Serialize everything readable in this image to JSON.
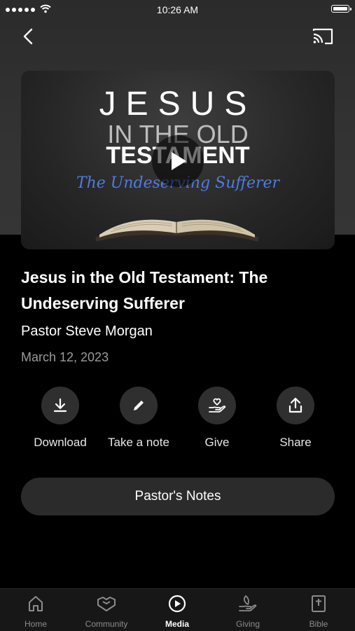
{
  "status_bar": {
    "time": "10:26 AM"
  },
  "thumbnail": {
    "line1": "JESUS",
    "line2": "IN THE OLD",
    "line3": "TESTAMENT",
    "line4": "The Undeserving Sufferer"
  },
  "sermon": {
    "title": "Jesus in the Old Testament: The Undeserving Sufferer",
    "pastor": "Pastor Steve Morgan",
    "date": "March 12, 2023"
  },
  "actions": [
    {
      "label": "Download",
      "icon": "download-icon"
    },
    {
      "label": "Take a note",
      "icon": "pencil-icon"
    },
    {
      "label": "Give",
      "icon": "give-hand-heart-icon"
    },
    {
      "label": "Share",
      "icon": "share-icon"
    }
  ],
  "notes_button": {
    "label": "Pastor's Notes"
  },
  "tabbar": {
    "active": "Media",
    "tabs": [
      {
        "label": "Home",
        "icon": "home-icon"
      },
      {
        "label": "Community",
        "icon": "community-icon"
      },
      {
        "label": "Media",
        "icon": "media-play-icon"
      },
      {
        "label": "Giving",
        "icon": "giving-icon"
      },
      {
        "label": "Bible",
        "icon": "bible-icon"
      }
    ]
  },
  "colors": {
    "accent_script": "#4f7be0",
    "background": "#000000",
    "button_bg": "#2f2f2f"
  }
}
